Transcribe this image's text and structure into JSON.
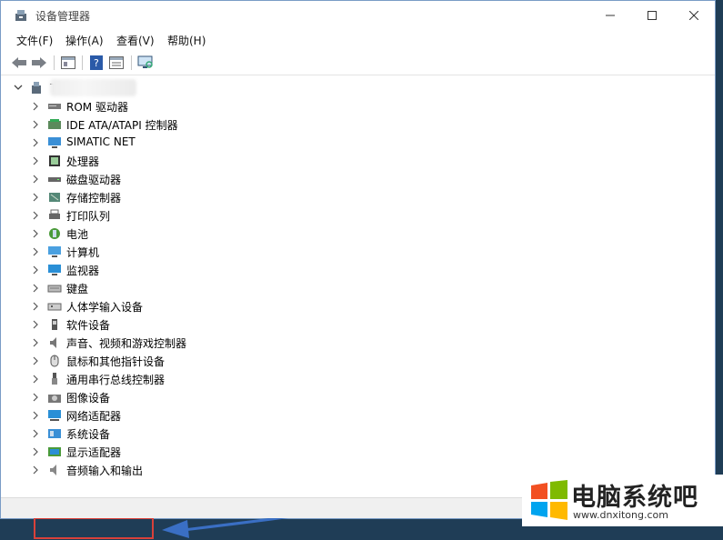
{
  "window": {
    "title": "设备管理器"
  },
  "menu": {
    "file": "文件(F)",
    "action": "操作(A)",
    "view": "查看(V)",
    "help": "帮助(H)"
  },
  "tree": {
    "root_label": "T",
    "items": [
      {
        "label": "ROM 驱动器",
        "icon": "dvd-drive-icon"
      },
      {
        "label": "IDE ATA/ATAPI 控制器",
        "icon": "ide-controller-icon"
      },
      {
        "label": "SIMATIC NET",
        "icon": "network-icon"
      },
      {
        "label": "处理器",
        "icon": "processor-icon"
      },
      {
        "label": "磁盘驱动器",
        "icon": "disk-drive-icon"
      },
      {
        "label": "存储控制器",
        "icon": "storage-controller-icon"
      },
      {
        "label": "打印队列",
        "icon": "printer-icon"
      },
      {
        "label": "电池",
        "icon": "battery-icon"
      },
      {
        "label": "计算机",
        "icon": "computer-icon"
      },
      {
        "label": "监视器",
        "icon": "monitor-icon"
      },
      {
        "label": "键盘",
        "icon": "keyboard-icon"
      },
      {
        "label": "人体学输入设备",
        "icon": "hid-icon"
      },
      {
        "label": "软件设备",
        "icon": "software-device-icon"
      },
      {
        "label": "声音、视频和游戏控制器",
        "icon": "sound-icon"
      },
      {
        "label": "鼠标和其他指针设备",
        "icon": "mouse-icon"
      },
      {
        "label": "通用串行总线控制器",
        "icon": "usb-icon"
      },
      {
        "label": "图像设备",
        "icon": "camera-icon"
      },
      {
        "label": "网络适配器",
        "icon": "network-adapter-icon"
      },
      {
        "label": "系统设备",
        "icon": "system-device-icon"
      },
      {
        "label": "显示适配器",
        "icon": "display-adapter-icon"
      },
      {
        "label": "音频输入和输出",
        "icon": "audio-io-icon"
      }
    ]
  },
  "watermark": {
    "title": "电脑系统吧",
    "url": "www.dnxitong.com"
  },
  "colors": {
    "highlight": "#d9413a",
    "arrow": "#3a6fc4",
    "accent_blue": "#1e8fd6"
  }
}
